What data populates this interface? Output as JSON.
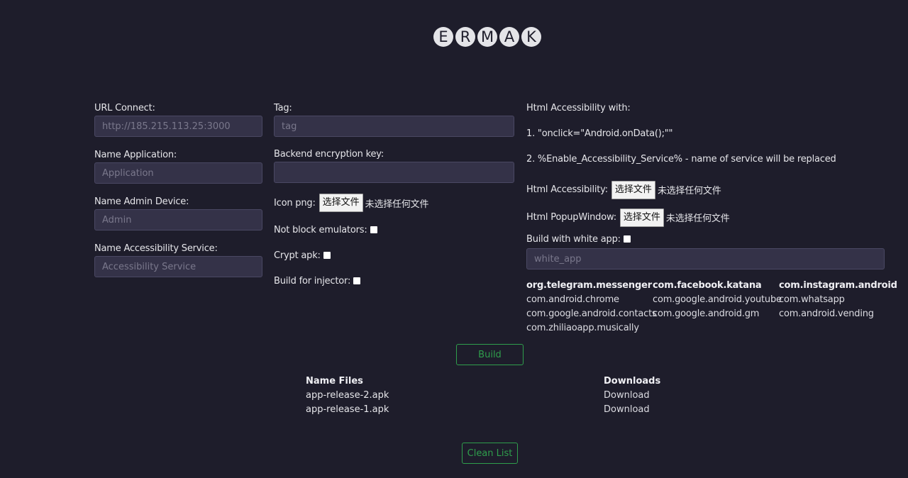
{
  "logo": {
    "letters": [
      "E",
      "R",
      "M",
      "A",
      "K"
    ]
  },
  "left_column": {
    "url_connect": {
      "label": "URL Connect:",
      "value": "",
      "placeholder": "http://185.215.113.25:3000"
    },
    "name_application": {
      "label": "Name Application:",
      "value": "",
      "placeholder": "Application"
    },
    "name_admin_device": {
      "label": "Name Admin Device:",
      "value": "",
      "placeholder": "Admin"
    },
    "name_accessibility_service": {
      "label": "Name Accessibility Service:",
      "value": "",
      "placeholder": "Accessibility Service"
    }
  },
  "middle_column": {
    "tag": {
      "label": "Tag:",
      "value": "",
      "placeholder": "tag"
    },
    "backend_key": {
      "label": "Backend encryption key:",
      "value": "",
      "placeholder": ""
    },
    "icon_png": {
      "label": "Icon png:",
      "button": "选择文件",
      "status": "未选择任何文件"
    },
    "not_block_emulators": {
      "label": "Not block emulators:",
      "checked": false
    },
    "crypt_apk": {
      "label": "Crypt apk:",
      "checked": false
    },
    "build_for_injector": {
      "label": "Build for injector:",
      "checked": false
    }
  },
  "right_column": {
    "info_title": "Html Accessibility with:",
    "info_line1": "1. \"onclick=\"Android.onData();\"\"",
    "info_line2": "2. %Enable_Accessibility_Service% - name of service will be replaced",
    "html_accessibility": {
      "label": "Html Accessibility:",
      "button": "选择文件",
      "status": "未选择任何文件"
    },
    "html_popup": {
      "label": "Html PopupWindow:",
      "button": "选择文件",
      "status": "未选择任何文件"
    },
    "white_app": {
      "label": "Build with white app:",
      "checked": false,
      "value": "",
      "placeholder": "white_app"
    },
    "packages": [
      {
        "name": "org.telegram.messenger",
        "bold": true
      },
      {
        "name": "com.facebook.katana",
        "bold": true
      },
      {
        "name": "com.instagram.android",
        "bold": true
      },
      {
        "name": "com.android.chrome",
        "bold": false
      },
      {
        "name": "com.google.android.youtube",
        "bold": false
      },
      {
        "name": "com.whatsapp",
        "bold": false
      },
      {
        "name": "com.google.android.contacts",
        "bold": false
      },
      {
        "name": "com.google.android.gm",
        "bold": false
      },
      {
        "name": "com.android.vending",
        "bold": false
      },
      {
        "name": "com.zhiliaoapp.musically",
        "bold": false
      }
    ]
  },
  "build_button": "Build",
  "files_table": {
    "headers": [
      "Name Files",
      "Downloads"
    ],
    "rows": [
      {
        "name": "app-release-2.apk",
        "action": "Download"
      },
      {
        "name": "app-release-1.apk",
        "action": "Download"
      }
    ]
  },
  "clean_button": "Clean List",
  "colors": {
    "background": "#1e1d2b",
    "input_bg": "#343248",
    "accent_green": "#2f9e4c"
  }
}
